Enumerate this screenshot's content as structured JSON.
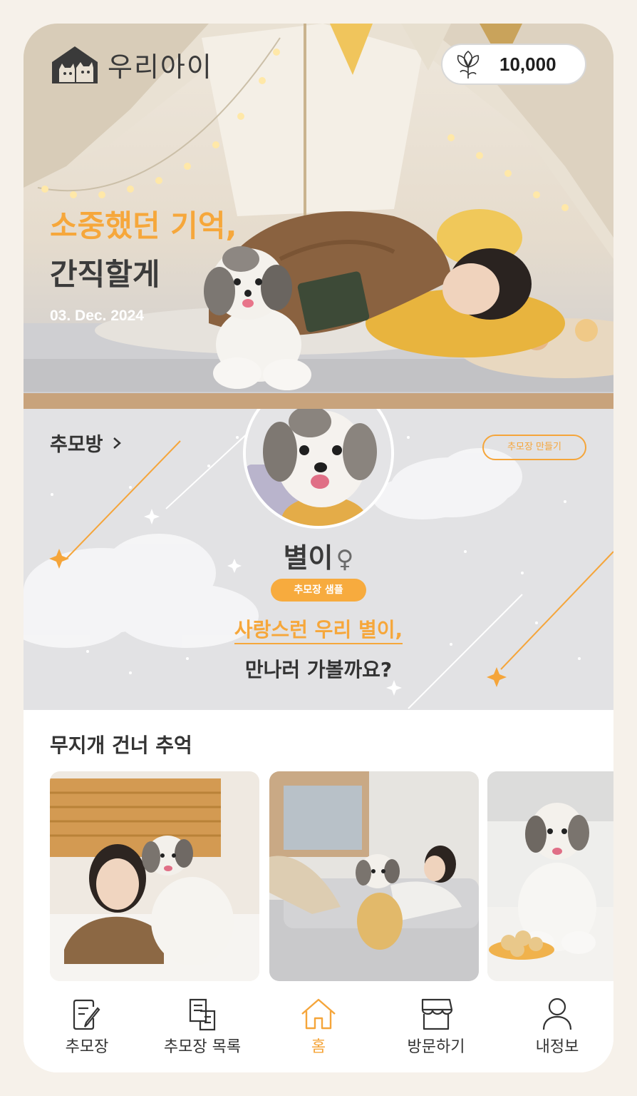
{
  "header": {
    "logo_text": "우리아이",
    "points": "10,000"
  },
  "hero": {
    "line1": "소중했던 기억,",
    "line2": "간직할게",
    "date": "03. Dec. 2024"
  },
  "memorial": {
    "link_label": "추모방",
    "create_button": "추모장 만들기",
    "pet_name": "별이",
    "pet_sex_symbol": "♀",
    "badge": "추모장 샘플",
    "message_line1": "사랑스런 우리 별이,",
    "message_line2": "만나러 가볼까요?"
  },
  "rainbow": {
    "title": "무지개 건너 추억"
  },
  "nav": {
    "items": [
      {
        "label": "추모장",
        "icon": "memorial-write-icon"
      },
      {
        "label": "추모장 목록",
        "icon": "document-list-icon"
      },
      {
        "label": "홈",
        "icon": "home-icon"
      },
      {
        "label": "방문하기",
        "icon": "store-icon"
      },
      {
        "label": "내정보",
        "icon": "user-icon"
      }
    ],
    "active": "홈"
  },
  "colors": {
    "accent": "#f5a53a",
    "text": "#333333",
    "memorial_bg": "#e2e2e4"
  }
}
